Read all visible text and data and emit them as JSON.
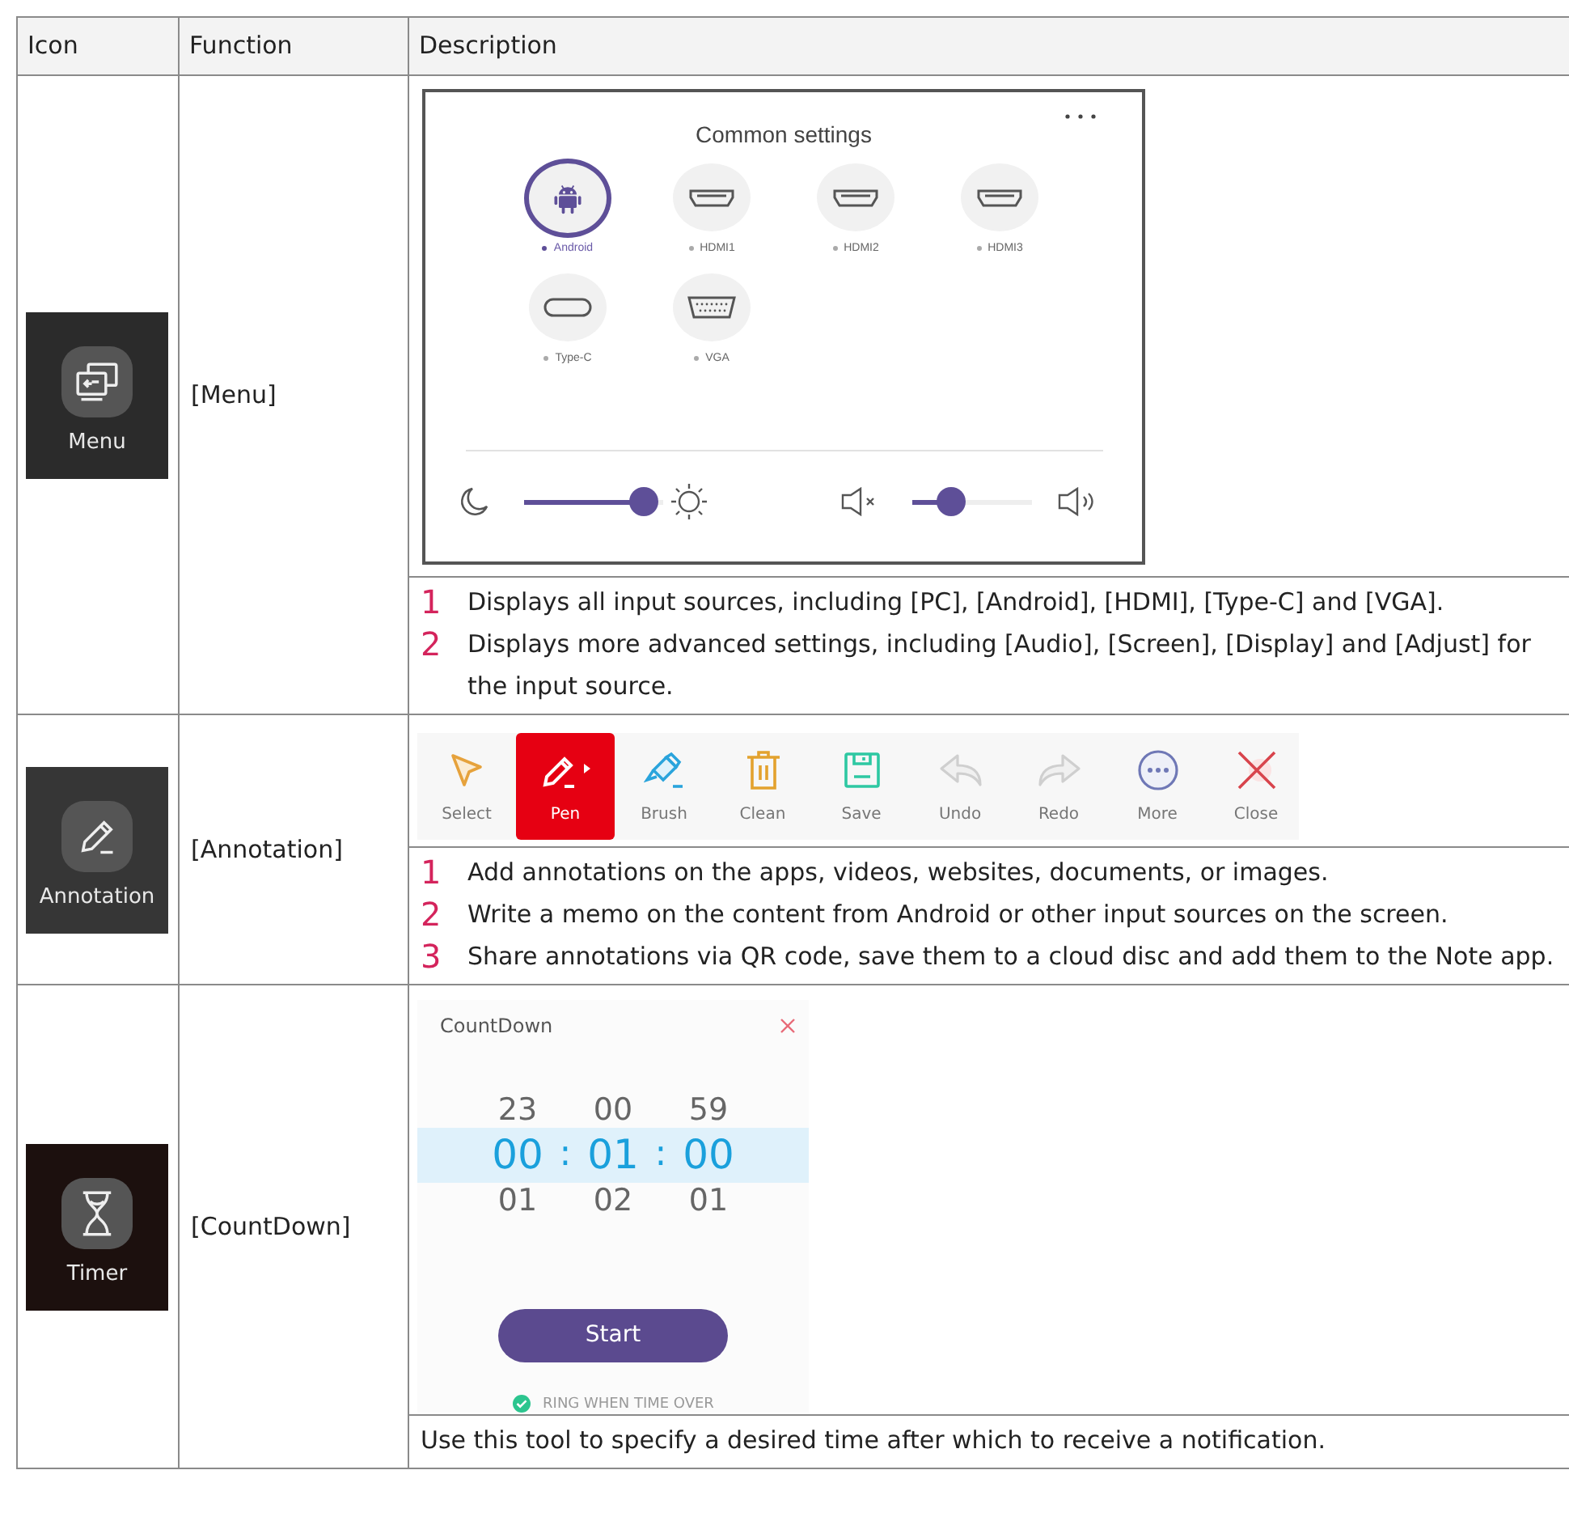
{
  "table": {
    "columns": [
      "Icon",
      "Function",
      "Description"
    ],
    "rows": [
      {
        "kind": "menu",
        "tile": {
          "kind": "screens",
          "label": "Menu"
        },
        "function": "[Menu]",
        "settings": {
          "title": "Common settings",
          "sources": [
            {
              "label": "Android",
              "kind": "android",
              "selected": true
            },
            {
              "label": "HDMI1",
              "kind": "hdmi",
              "selected": false
            },
            {
              "label": "HDMI2",
              "kind": "hdmi",
              "selected": false
            },
            {
              "label": "HDMI3",
              "kind": "hdmi",
              "selected": false
            },
            {
              "label": "Type-C",
              "kind": "typec",
              "selected": false
            },
            {
              "label": "VGA",
              "kind": "vga",
              "selected": false
            }
          ],
          "brightness": {
            "level": 0.86
          },
          "volume": {
            "level": 0.32
          }
        },
        "notes": [
          {
            "number": "1",
            "text": "Displays all input sources, including [PC], [Android], [HDMI], [Type-C] and [VGA]."
          },
          {
            "number": "2",
            "text": "Displays more advanced settings, including [Audio], [Screen], [Display] and [Adjust] for the input source."
          }
        ]
      },
      {
        "kind": "annotation",
        "tile": {
          "kind": "pencil",
          "label": "Annotation"
        },
        "function": "[Annotation]",
        "toolbar": [
          {
            "label": "Select",
            "kind": "cursor",
            "selected": false,
            "disabled": false
          },
          {
            "label": "Pen",
            "kind": "pen",
            "selected": true,
            "disabled": false
          },
          {
            "label": "Brush",
            "kind": "brush",
            "selected": false,
            "disabled": false
          },
          {
            "label": "Clean",
            "kind": "trash",
            "selected": false,
            "disabled": false
          },
          {
            "label": "Save",
            "kind": "save",
            "selected": false,
            "disabled": false
          },
          {
            "label": "Undo",
            "kind": "undo",
            "selected": false,
            "disabled": true
          },
          {
            "label": "Redo",
            "kind": "redo",
            "selected": false,
            "disabled": true
          },
          {
            "label": "More",
            "kind": "more",
            "selected": false,
            "disabled": false
          },
          {
            "label": "Close",
            "kind": "close",
            "selected": false,
            "disabled": false
          }
        ],
        "notes": [
          {
            "number": "1",
            "text": "Add annotations on the apps, videos, websites, documents, or images."
          },
          {
            "number": "2",
            "text": "Write a memo on the content from Android or other input sources on the screen."
          },
          {
            "number": "3",
            "text": "Share annotations via QR code, save them to a cloud disc and add them to the Note app."
          }
        ]
      },
      {
        "kind": "countdown",
        "tile": {
          "kind": "hourglass",
          "label": "Timer"
        },
        "function": "[CountDown]",
        "countdown": {
          "title": "CountDown",
          "columns": [
            {
              "above": "23",
              "value": "00",
              "below": "01"
            },
            {
              "above": "00",
              "value": "01",
              "below": "02"
            },
            {
              "above": "59",
              "value": "00",
              "below": "01"
            }
          ],
          "separators": [
            ":",
            ":"
          ],
          "button": "Start",
          "ring": {
            "label": "RING WHEN TIME OVER",
            "checked": true
          }
        },
        "notes": [
          {
            "text": "Use this tool to specify a desired time after which to receive a notification."
          }
        ]
      }
    ]
  }
}
